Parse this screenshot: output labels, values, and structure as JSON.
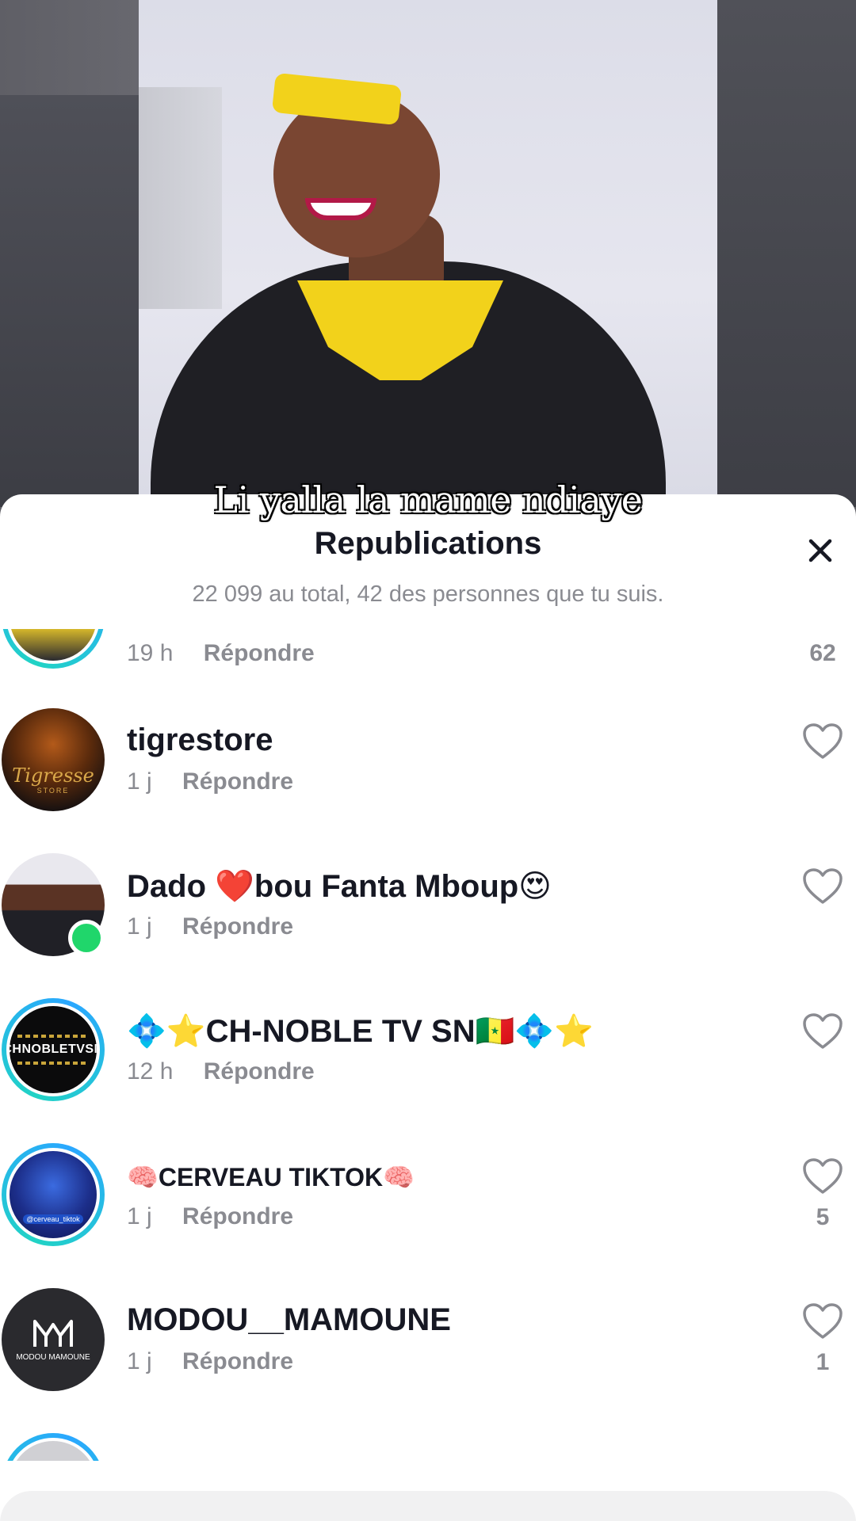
{
  "video": {
    "caption": "Li yalla la mame ndiaye"
  },
  "sheet": {
    "title": "Republications",
    "subtitle": "22 099 au total, 42 des personnes que tu suis.",
    "close_icon": "close-icon"
  },
  "partial_top_row": {
    "time": "19 h",
    "reply": "Répondre",
    "likes": "62"
  },
  "rows": [
    {
      "name": "tigrestore",
      "time": "1 j",
      "reply": "Répondre",
      "likes": "",
      "avatar_text": "Tigresse",
      "avatar_sub": "STORE"
    },
    {
      "name": "Dado ❤️bou Fanta Mboup😍",
      "time": "1 j",
      "reply": "Répondre",
      "likes": "",
      "online": true
    },
    {
      "name": "💠⭐CH-NOBLE TV SN🇸🇳💠⭐",
      "time": "12 h",
      "reply": "Répondre",
      "likes": "",
      "avatar_text": "CHNOBLETVSN"
    },
    {
      "name": "🧠CERVEAU TIKTOK🧠",
      "time": "1 j",
      "reply": "Répondre",
      "likes": "5",
      "avatar_text": "@cerveau_tiktok"
    },
    {
      "name": "MODOU__MAMOUNE",
      "time": "1 j",
      "reply": "Répondre",
      "likes": "1",
      "avatar_text": "MODOU MAMOUNE"
    }
  ],
  "colors": {
    "ring": "#21d3c5",
    "online": "#20d66b",
    "muted_text": "#8a8b91",
    "primary_text": "#161823"
  }
}
